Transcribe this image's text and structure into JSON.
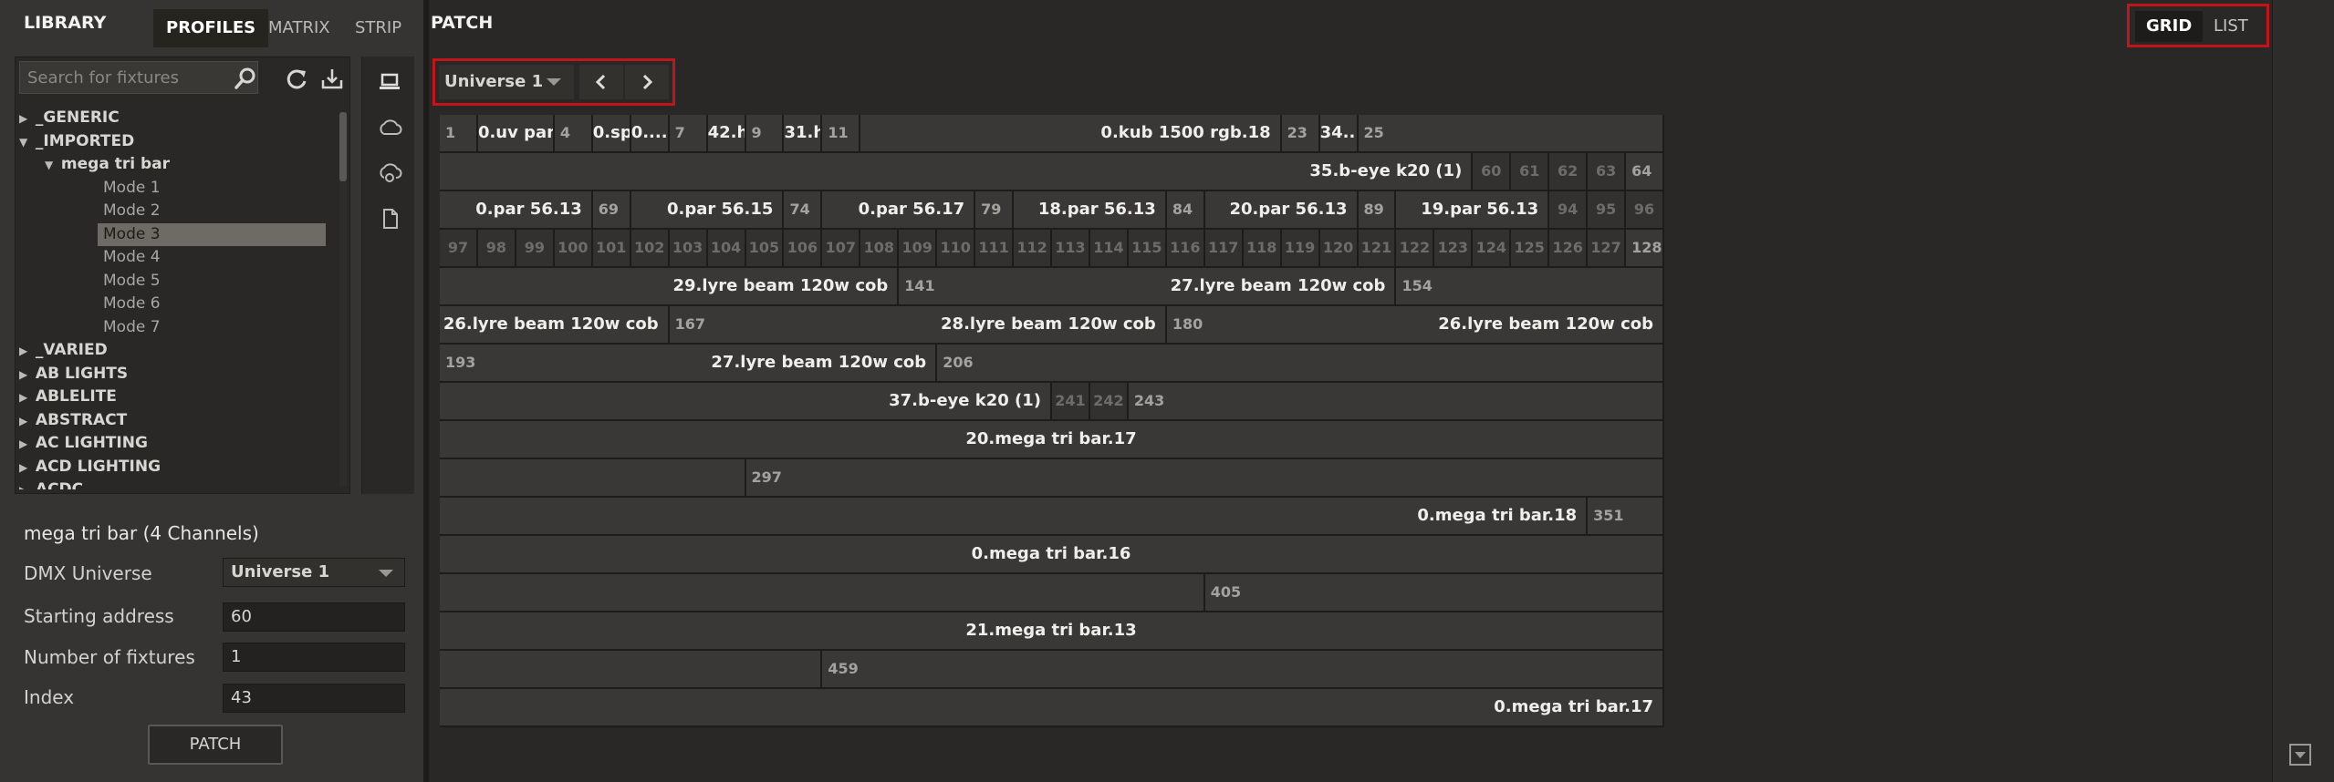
{
  "library": {
    "title": "LIBRARY",
    "tabs": [
      "PROFILES",
      "MATRIX",
      "STRIP"
    ],
    "active_tab": "PROFILES",
    "search_placeholder": "Search for fixtures",
    "tree": [
      {
        "label": "_GENERIC",
        "type": "folder",
        "expanded": false
      },
      {
        "label": "_IMPORTED",
        "type": "folder",
        "expanded": true
      },
      {
        "label": "mega tri bar",
        "type": "folder",
        "expanded": true
      },
      {
        "label": "Mode 1",
        "type": "mode"
      },
      {
        "label": "Mode 2",
        "type": "mode"
      },
      {
        "label": "Mode 3",
        "type": "mode",
        "selected": true
      },
      {
        "label": "Mode 4",
        "type": "mode"
      },
      {
        "label": "Mode 5",
        "type": "mode"
      },
      {
        "label": "Mode 6",
        "type": "mode"
      },
      {
        "label": "Mode 7",
        "type": "mode"
      },
      {
        "label": "_VARIED",
        "type": "folder",
        "expanded": false
      },
      {
        "label": "AB LIGHTS",
        "type": "folder",
        "expanded": false
      },
      {
        "label": "ABLELITE",
        "type": "folder",
        "expanded": false
      },
      {
        "label": "ABSTRACT",
        "type": "folder",
        "expanded": false
      },
      {
        "label": "AC LIGHTING",
        "type": "folder",
        "expanded": false
      },
      {
        "label": "ACD LIGHTING",
        "type": "folder",
        "expanded": false
      },
      {
        "label": "ACDC",
        "type": "folder",
        "expanded": false
      }
    ]
  },
  "properties": {
    "title": "mega tri bar (4 Channels)",
    "dmx_universe_label": "DMX Universe",
    "dmx_universe_value": "Universe 1",
    "starting_address_label": "Starting address",
    "starting_address_value": "60",
    "num_fixtures_label": "Number of fixtures",
    "num_fixtures_value": "1",
    "index_label": "Index",
    "index_value": "43",
    "patch_button": "PATCH"
  },
  "patch": {
    "title": "PATCH",
    "view_grid": "GRID",
    "view_list": "LIST",
    "universe": "Universe 1"
  },
  "grid": {
    "rows": [
      [
        {
          "t": "1",
          "s": 1,
          "e": 1,
          "k": "addr"
        },
        {
          "t": "0.uv pane...",
          "s": 2,
          "e": 3,
          "k": "fx"
        },
        {
          "t": "4",
          "s": 4,
          "e": 4,
          "k": "addr"
        },
        {
          "t": "0.sp ...",
          "s": 5,
          "e": 5,
          "k": "fx"
        },
        {
          "t": "0....",
          "s": 6,
          "e": 6,
          "k": "fx"
        },
        {
          "t": "7",
          "s": 7,
          "e": 7,
          "k": "addr"
        },
        {
          "t": "42.h...",
          "s": 8,
          "e": 8,
          "k": "fx"
        },
        {
          "t": "9",
          "s": 9,
          "e": 9,
          "k": "addr"
        },
        {
          "t": "31.h...",
          "s": 10,
          "e": 10,
          "k": "fx"
        },
        {
          "t": "11",
          "s": 11,
          "e": 11,
          "k": "addr"
        },
        {
          "t": "0.kub 1500 rgb.18",
          "s": 12,
          "e": 22,
          "k": "fx"
        },
        {
          "t": "23",
          "s": 23,
          "e": 23,
          "k": "addr"
        },
        {
          "t": "34....",
          "s": 24,
          "e": 24,
          "k": "fx"
        },
        {
          "t": "25",
          "s": 25,
          "e": 32,
          "k": "addr"
        }
      ],
      [
        {
          "t": "35.b-eye k20 (1)",
          "s": 33,
          "e": 59,
          "k": "fx"
        },
        {
          "t": "60",
          "s": 60,
          "e": 60,
          "k": "dim"
        },
        {
          "t": "61",
          "s": 61,
          "e": 61,
          "k": "dim"
        },
        {
          "t": "62",
          "s": 62,
          "e": 62,
          "k": "dim"
        },
        {
          "t": "63",
          "s": 63,
          "e": 63,
          "k": "dim"
        },
        {
          "t": "64",
          "s": 64,
          "e": 64,
          "k": "addr"
        }
      ],
      [
        {
          "t": "0.par 56.13",
          "s": 65,
          "e": 68,
          "k": "fx"
        },
        {
          "t": "69",
          "s": 69,
          "e": 69,
          "k": "addr"
        },
        {
          "t": "0.par 56.15",
          "s": 70,
          "e": 73,
          "k": "fx"
        },
        {
          "t": "74",
          "s": 74,
          "e": 74,
          "k": "addr"
        },
        {
          "t": "0.par 56.17",
          "s": 75,
          "e": 78,
          "k": "fx"
        },
        {
          "t": "79",
          "s": 79,
          "e": 79,
          "k": "addr"
        },
        {
          "t": "18.par 56.13",
          "s": 80,
          "e": 83,
          "k": "fx"
        },
        {
          "t": "84",
          "s": 84,
          "e": 84,
          "k": "addr"
        },
        {
          "t": "20.par 56.13",
          "s": 85,
          "e": 88,
          "k": "fx"
        },
        {
          "t": "89",
          "s": 89,
          "e": 89,
          "k": "addr"
        },
        {
          "t": "19.par 56.13",
          "s": 90,
          "e": 93,
          "k": "fx"
        },
        {
          "t": "94",
          "s": 94,
          "e": 94,
          "k": "dim"
        },
        {
          "t": "95",
          "s": 95,
          "e": 95,
          "k": "dim"
        },
        {
          "t": "96",
          "s": 96,
          "e": 96,
          "k": "dim"
        }
      ],
      [
        {
          "t": "97",
          "s": 97,
          "e": 97,
          "k": "dim"
        },
        {
          "t": "98",
          "s": 98,
          "e": 98,
          "k": "dim"
        },
        {
          "t": "99",
          "s": 99,
          "e": 99,
          "k": "dim"
        },
        {
          "t": "100",
          "s": 100,
          "e": 100,
          "k": "dim"
        },
        {
          "t": "101",
          "s": 101,
          "e": 101,
          "k": "dim"
        },
        {
          "t": "102",
          "s": 102,
          "e": 102,
          "k": "dim"
        },
        {
          "t": "103",
          "s": 103,
          "e": 103,
          "k": "dim"
        },
        {
          "t": "104",
          "s": 104,
          "e": 104,
          "k": "dim"
        },
        {
          "t": "105",
          "s": 105,
          "e": 105,
          "k": "dim"
        },
        {
          "t": "106",
          "s": 106,
          "e": 106,
          "k": "dim"
        },
        {
          "t": "107",
          "s": 107,
          "e": 107,
          "k": "dim"
        },
        {
          "t": "108",
          "s": 108,
          "e": 108,
          "k": "dim"
        },
        {
          "t": "109",
          "s": 109,
          "e": 109,
          "k": "dim"
        },
        {
          "t": "110",
          "s": 110,
          "e": 110,
          "k": "dim"
        },
        {
          "t": "111",
          "s": 111,
          "e": 111,
          "k": "dim"
        },
        {
          "t": "112",
          "s": 112,
          "e": 112,
          "k": "dim"
        },
        {
          "t": "113",
          "s": 113,
          "e": 113,
          "k": "dim"
        },
        {
          "t": "114",
          "s": 114,
          "e": 114,
          "k": "dim"
        },
        {
          "t": "115",
          "s": 115,
          "e": 115,
          "k": "dim"
        },
        {
          "t": "116",
          "s": 116,
          "e": 116,
          "k": "dim"
        },
        {
          "t": "117",
          "s": 117,
          "e": 117,
          "k": "dim"
        },
        {
          "t": "118",
          "s": 118,
          "e": 118,
          "k": "dim"
        },
        {
          "t": "119",
          "s": 119,
          "e": 119,
          "k": "dim"
        },
        {
          "t": "120",
          "s": 120,
          "e": 120,
          "k": "dim"
        },
        {
          "t": "121",
          "s": 121,
          "e": 121,
          "k": "dim"
        },
        {
          "t": "122",
          "s": 122,
          "e": 122,
          "k": "dim"
        },
        {
          "t": "123",
          "s": 123,
          "e": 123,
          "k": "dim"
        },
        {
          "t": "124",
          "s": 124,
          "e": 124,
          "k": "dim"
        },
        {
          "t": "125",
          "s": 125,
          "e": 125,
          "k": "dim"
        },
        {
          "t": "126",
          "s": 126,
          "e": 126,
          "k": "dim"
        },
        {
          "t": "127",
          "s": 127,
          "e": 127,
          "k": "dim"
        },
        {
          "t": "128",
          "s": 128,
          "e": 128,
          "k": "addr"
        }
      ],
      [
        {
          "t": "29.lyre beam 120w cob",
          "s": 129,
          "e": 140,
          "k": "fx"
        },
        {
          "t": "141",
          "s": 141,
          "e": 153,
          "k": "addr",
          "fx": "27.lyre beam 120w cob"
        },
        {
          "t": "154",
          "s": 154,
          "e": 160,
          "k": "addr"
        }
      ],
      [
        {
          "t": "26.lyre beam 120w cob",
          "s": 161,
          "e": 166,
          "k": "fx"
        },
        {
          "t": "167",
          "s": 167,
          "e": 179,
          "k": "addr",
          "fx": "28.lyre beam 120w cob"
        },
        {
          "t": "180",
          "s": 180,
          "e": 192,
          "k": "addr",
          "fx": "26.lyre beam 120w cob"
        }
      ],
      [
        {
          "t": "193",
          "s": 193,
          "e": 205,
          "k": "addr",
          "fx": "27.lyre beam 120w cob"
        },
        {
          "t": "206",
          "s": 206,
          "e": 224,
          "k": "addr"
        }
      ],
      [
        {
          "t": "37.b-eye k20 (1)",
          "s": 225,
          "e": 240,
          "k": "fx"
        },
        {
          "t": "241",
          "s": 241,
          "e": 241,
          "k": "dim"
        },
        {
          "t": "242",
          "s": 242,
          "e": 242,
          "k": "dim"
        },
        {
          "t": "243",
          "s": 243,
          "e": 256,
          "k": "addr"
        }
      ],
      [
        {
          "t": "20.mega tri bar.17",
          "s": 257,
          "e": 288,
          "k": "fx",
          "c": true
        }
      ],
      [
        {
          "t": "",
          "s": 289,
          "e": 296,
          "k": "fx"
        },
        {
          "t": "297",
          "s": 297,
          "e": 320,
          "k": "addr"
        }
      ],
      [
        {
          "t": "0.mega tri bar.18",
          "s": 321,
          "e": 350,
          "k": "fx"
        },
        {
          "t": "351",
          "s": 351,
          "e": 352,
          "k": "addr"
        }
      ],
      [
        {
          "t": "0.mega tri bar.16",
          "s": 353,
          "e": 384,
          "k": "fx",
          "c": true
        }
      ],
      [
        {
          "t": "",
          "s": 385,
          "e": 404,
          "k": "fx"
        },
        {
          "t": "405",
          "s": 405,
          "e": 416,
          "k": "addr"
        }
      ],
      [
        {
          "t": "21.mega tri bar.13",
          "s": 417,
          "e": 448,
          "k": "fx",
          "c": true
        }
      ],
      [
        {
          "t": "",
          "s": 449,
          "e": 458,
          "k": "fx"
        },
        {
          "t": "459",
          "s": 459,
          "e": 480,
          "k": "addr"
        }
      ],
      [
        {
          "t": "0.mega tri bar.17",
          "s": 481,
          "e": 512,
          "k": "fx"
        }
      ]
    ]
  }
}
